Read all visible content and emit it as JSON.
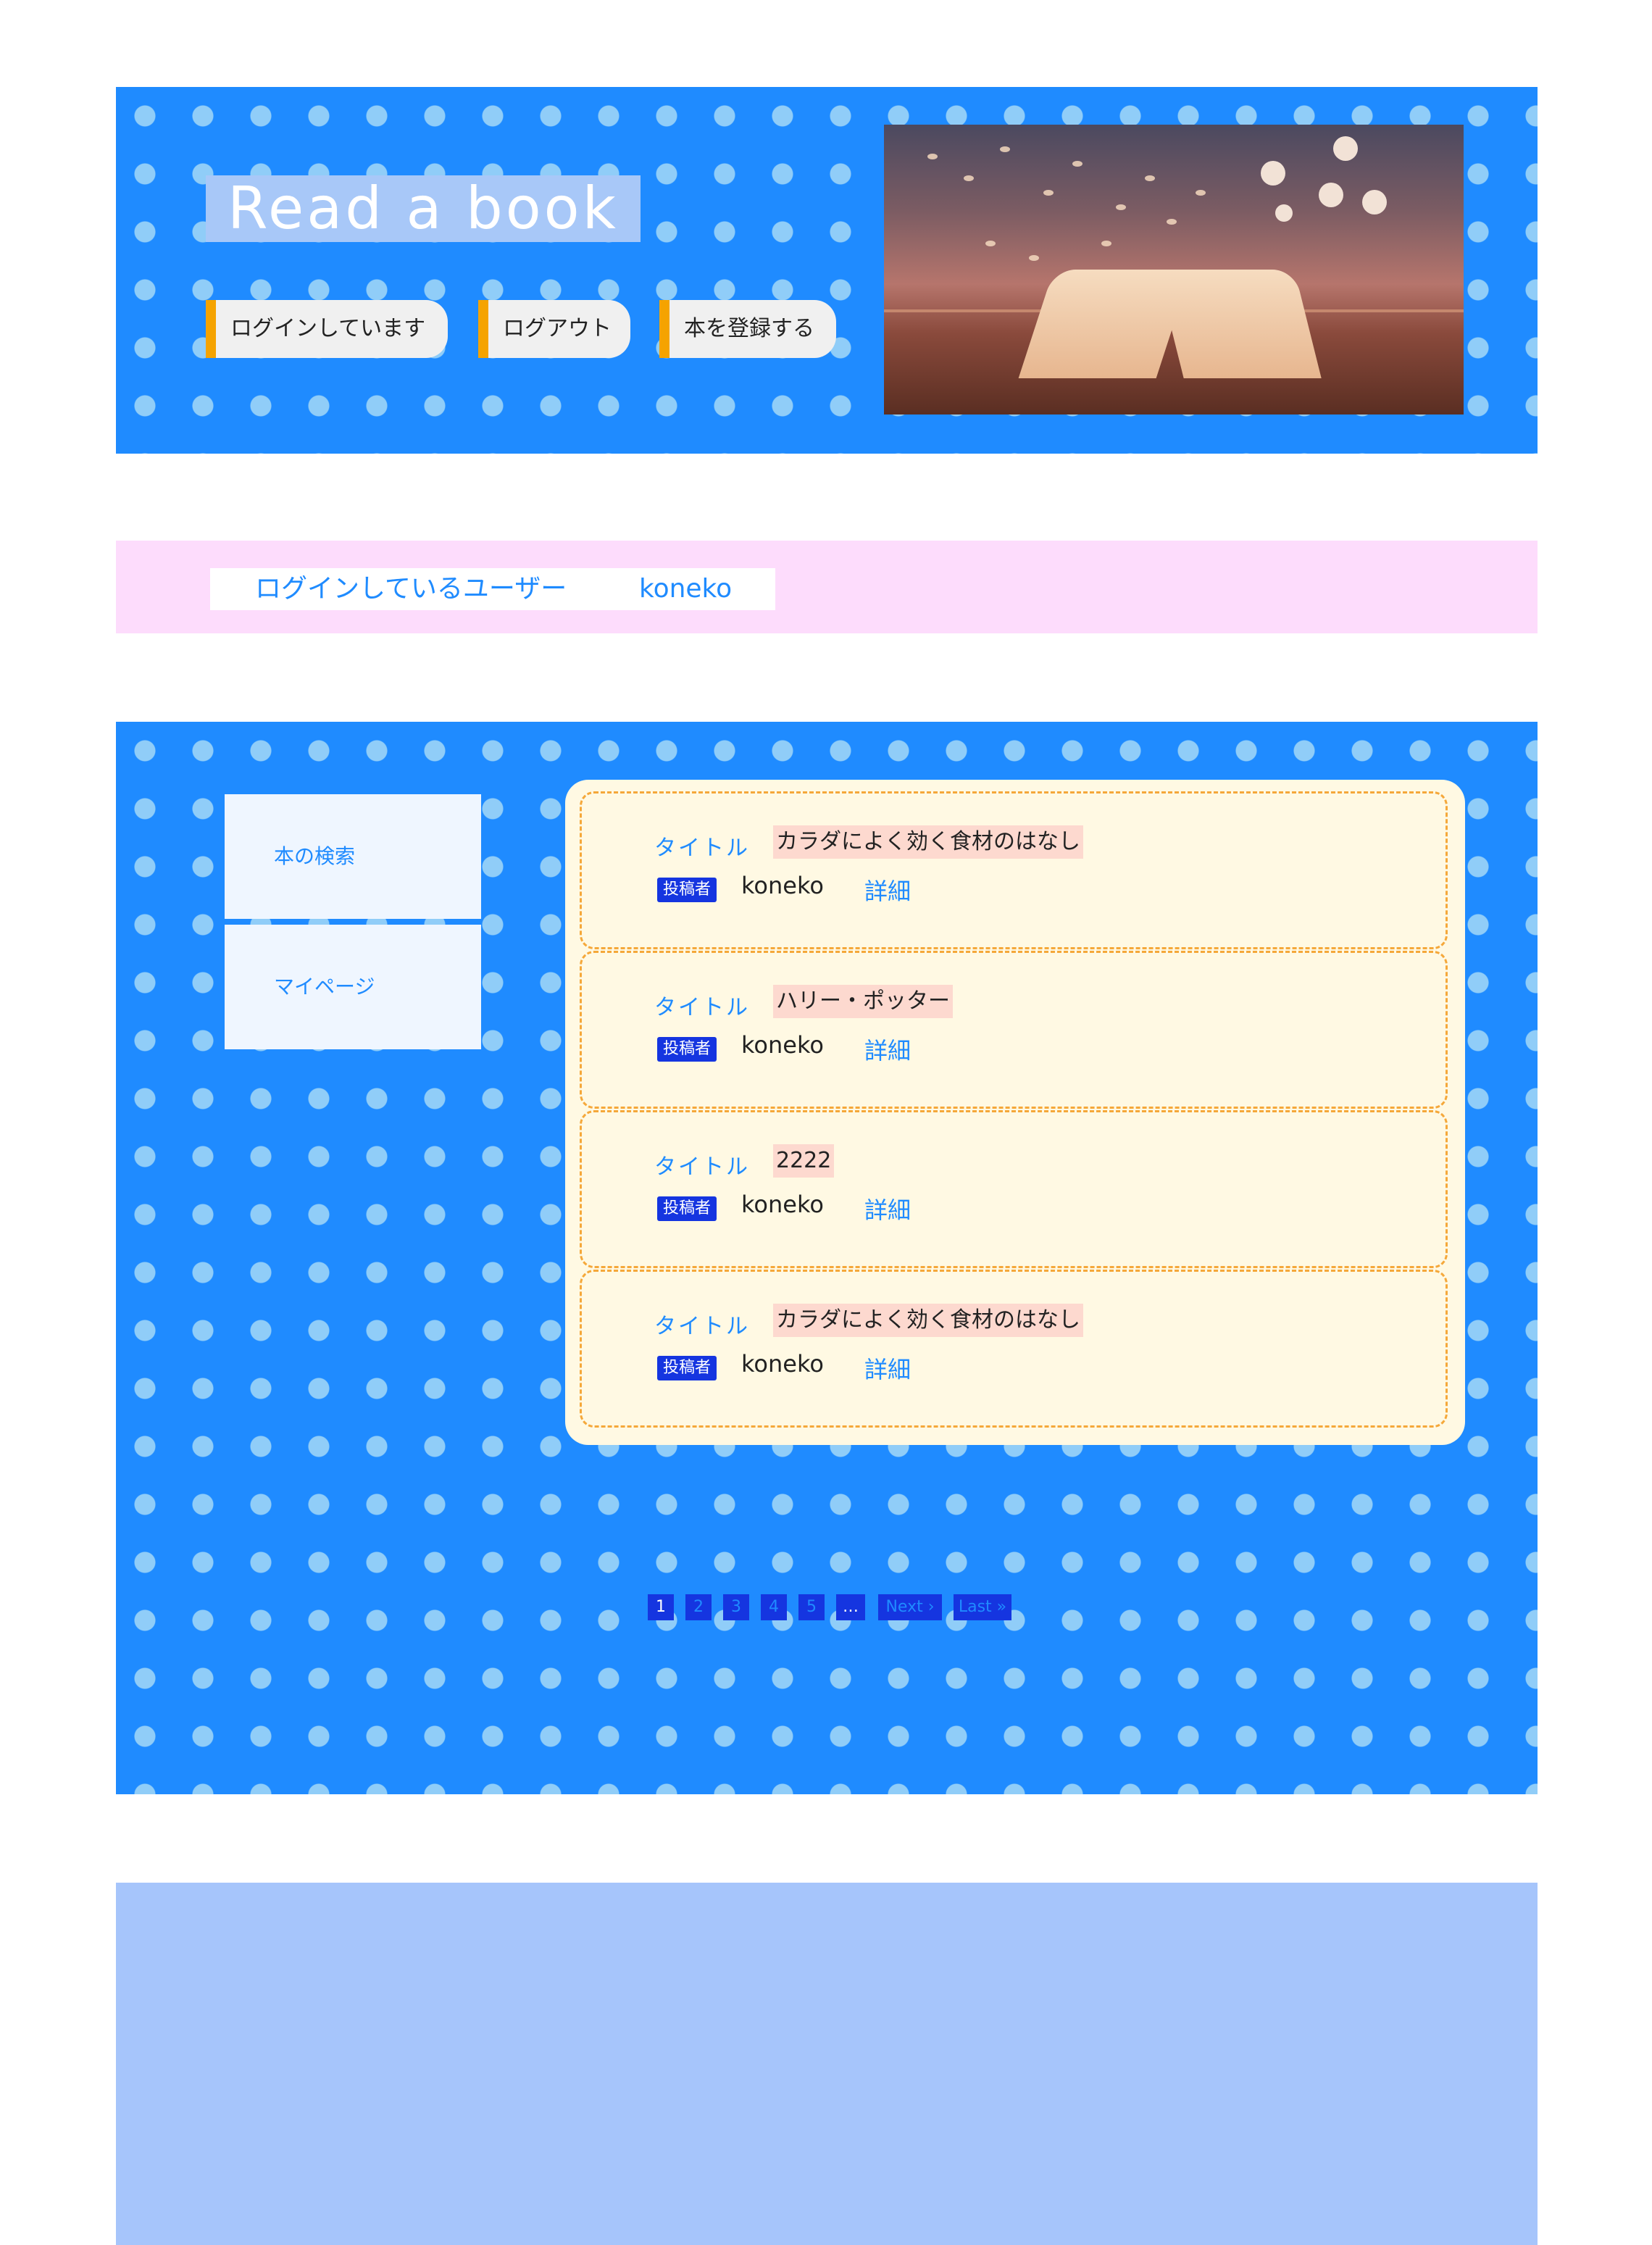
{
  "header": {
    "site_title": "Read a book",
    "nav": [
      "ログインしています",
      "ログアウト",
      "本を登録する"
    ],
    "hero_image_icon": "open-book-image"
  },
  "user_bar": {
    "label": "ログインしているユーザー",
    "username": "koneko"
  },
  "sidebar": {
    "items": [
      "本の検索",
      "マイページ"
    ]
  },
  "books": [
    {
      "title_label": "タイトル",
      "title": "カラダによく効く食材のはなし",
      "poster_label": "投稿者",
      "poster": "koneko",
      "detail": "詳細"
    },
    {
      "title_label": "タイトル",
      "title": "ハリー・ポッター",
      "poster_label": "投稿者",
      "poster": "koneko",
      "detail": "詳細"
    },
    {
      "title_label": "タイトル",
      "title": "2222",
      "poster_label": "投稿者",
      "poster": "koneko",
      "detail": "詳細"
    },
    {
      "title_label": "タイトル",
      "title": "カラダによく効く食材のはなし",
      "poster_label": "投稿者",
      "poster": "koneko",
      "detail": "詳細"
    }
  ],
  "pagination": {
    "pages": [
      "1",
      "2",
      "3",
      "4",
      "5"
    ],
    "ellipsis": "…",
    "next": "Next ›",
    "last": "Last »"
  },
  "colors": {
    "primary_blue": "#1f8bff",
    "dot_blue": "#90cdf8",
    "accent_orange": "#f5a300",
    "user_bar_pink": "#fddcfc",
    "footer_blue": "#a6c5fb",
    "card_bg": "#fff9e3"
  }
}
